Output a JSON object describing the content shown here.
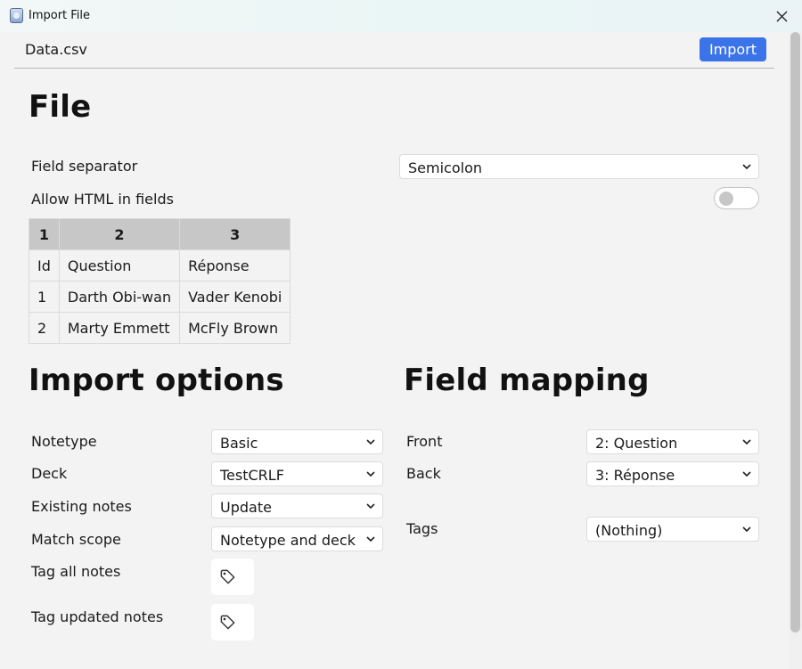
{
  "window": {
    "title": "Import File"
  },
  "header": {
    "file_name": "Data.csv",
    "import_label": "Import"
  },
  "file_section": {
    "heading": "File",
    "field_separator_label": "Field separator",
    "field_separator_value": "Semicolon",
    "allow_html_label": "Allow HTML in fields",
    "allow_html_on": false
  },
  "preview": {
    "columns": [
      "1",
      "2",
      "3"
    ],
    "rows": [
      [
        "Id",
        "Question",
        "Réponse"
      ],
      [
        "1",
        "Darth Obi-wan",
        "Vader Kenobi"
      ],
      [
        "2",
        "Marty Emmett",
        "McFly Brown"
      ]
    ]
  },
  "import_options": {
    "heading": "Import options",
    "notetype_label": "Notetype",
    "notetype_value": "Basic",
    "deck_label": "Deck",
    "deck_value": "TestCRLF",
    "existing_notes_label": "Existing notes",
    "existing_notes_value": "Update",
    "match_scope_label": "Match scope",
    "match_scope_value": "Notetype and deck",
    "tag_all_label": "Tag all notes",
    "tag_updated_label": "Tag updated notes"
  },
  "field_mapping": {
    "heading": "Field mapping",
    "front_label": "Front",
    "front_value": "2: Question",
    "back_label": "Back",
    "back_value": "3: Réponse",
    "tags_label": "Tags",
    "tags_value": "(Nothing)"
  },
  "icons": {
    "app": "app-icon",
    "close": "close-icon",
    "chevron": "chevron-down-icon",
    "tag": "tag-icon"
  },
  "colors": {
    "accent": "#3b74e8",
    "table_header": "#c7c7c7"
  }
}
